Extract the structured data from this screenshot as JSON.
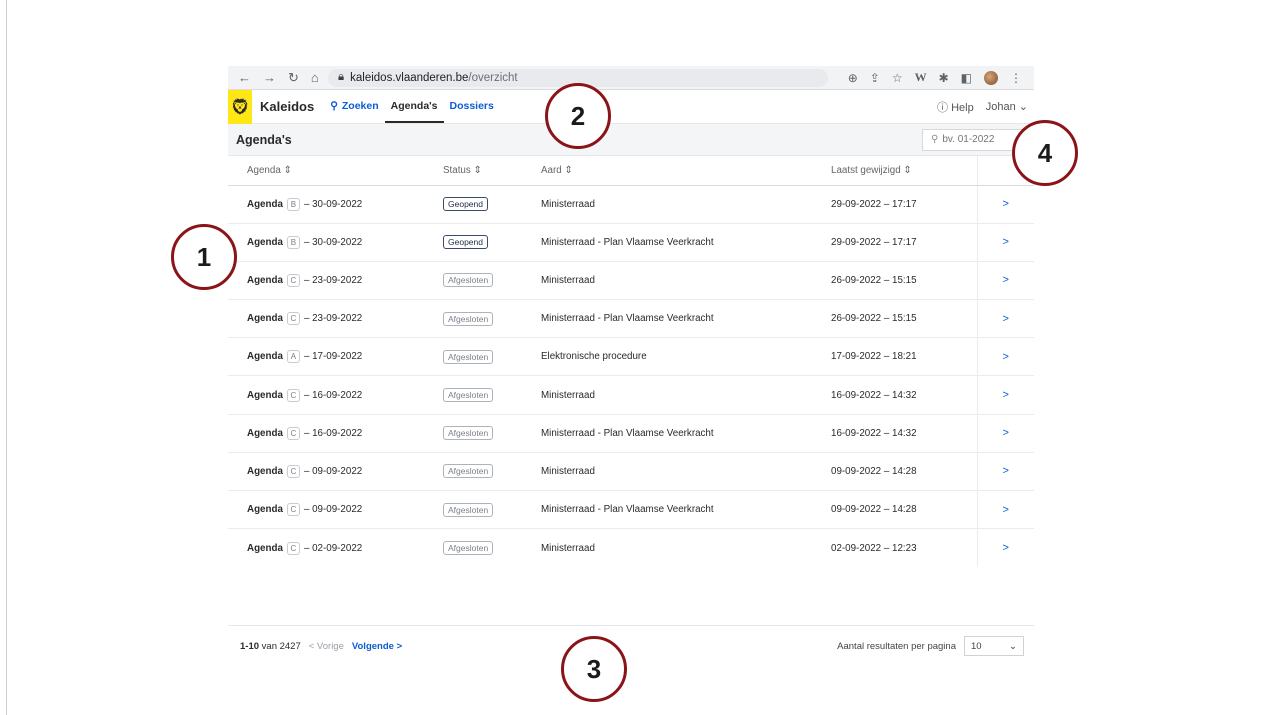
{
  "browser": {
    "host": "kaleidos.vlaanderen.be",
    "path": "/overzicht"
  },
  "app": {
    "brand": "Kaleidos",
    "nav": {
      "search": "Zoeken",
      "agendas": "Agenda's",
      "dossiers": "Dossiers"
    },
    "help": "Help",
    "user": "Johan"
  },
  "page": {
    "title": "Agenda's",
    "search_placeholder": "bv. 01-2022"
  },
  "table": {
    "headers": [
      "Agenda ⇕",
      "Status ⇕",
      "Aard ⇕",
      "Laatst gewijzigd ⇕"
    ],
    "rows": [
      {
        "label": "Agenda",
        "letter": "B",
        "date": "– 30-09-2022",
        "status": "Geopend",
        "aard": "Ministerraad",
        "modified": "29-09-2022 – 17:17"
      },
      {
        "label": "Agenda",
        "letter": "B",
        "date": "– 30-09-2022",
        "status": "Geopend",
        "aard": "Ministerraad - Plan Vlaamse Veerkracht",
        "modified": "29-09-2022 – 17:17"
      },
      {
        "label": "Agenda",
        "letter": "C",
        "date": "– 23-09-2022",
        "status": "Afgesloten",
        "aard": "Ministerraad",
        "modified": "26-09-2022 – 15:15"
      },
      {
        "label": "Agenda",
        "letter": "C",
        "date": "– 23-09-2022",
        "status": "Afgesloten",
        "aard": "Ministerraad - Plan Vlaamse Veerkracht",
        "modified": "26-09-2022 – 15:15"
      },
      {
        "label": "Agenda",
        "letter": "A",
        "date": "– 17-09-2022",
        "status": "Afgesloten",
        "aard": "Elektronische procedure",
        "modified": "17-09-2022 – 18:21"
      },
      {
        "label": "Agenda",
        "letter": "C",
        "date": "– 16-09-2022",
        "status": "Afgesloten",
        "aard": "Ministerraad",
        "modified": "16-09-2022 – 14:32"
      },
      {
        "label": "Agenda",
        "letter": "C",
        "date": "– 16-09-2022",
        "status": "Afgesloten",
        "aard": "Ministerraad - Plan Vlaamse Veerkracht",
        "modified": "16-09-2022 – 14:32"
      },
      {
        "label": "Agenda",
        "letter": "C",
        "date": "– 09-09-2022",
        "status": "Afgesloten",
        "aard": "Ministerraad",
        "modified": "09-09-2022 – 14:28"
      },
      {
        "label": "Agenda",
        "letter": "C",
        "date": "– 09-09-2022",
        "status": "Afgesloten",
        "aard": "Ministerraad - Plan Vlaamse Veerkracht",
        "modified": "09-09-2022 – 14:28"
      },
      {
        "label": "Agenda",
        "letter": "C",
        "date": "– 02-09-2022",
        "status": "Afgesloten",
        "aard": "Ministerraad",
        "modified": "02-09-2022 – 12:23"
      }
    ]
  },
  "pagination": {
    "range": "1-10",
    "of_label": "van 2427",
    "prev": "< Vorige",
    "next": "Volgende >",
    "per_page_label": "Aantal resultaten per pagina",
    "per_page_value": "10"
  },
  "annotations": [
    "1",
    "2",
    "3",
    "4"
  ],
  "colors": {
    "brand_yellow": "#ffe615",
    "link_blue": "#0b5cd5",
    "marker_red": "#8a1418"
  }
}
